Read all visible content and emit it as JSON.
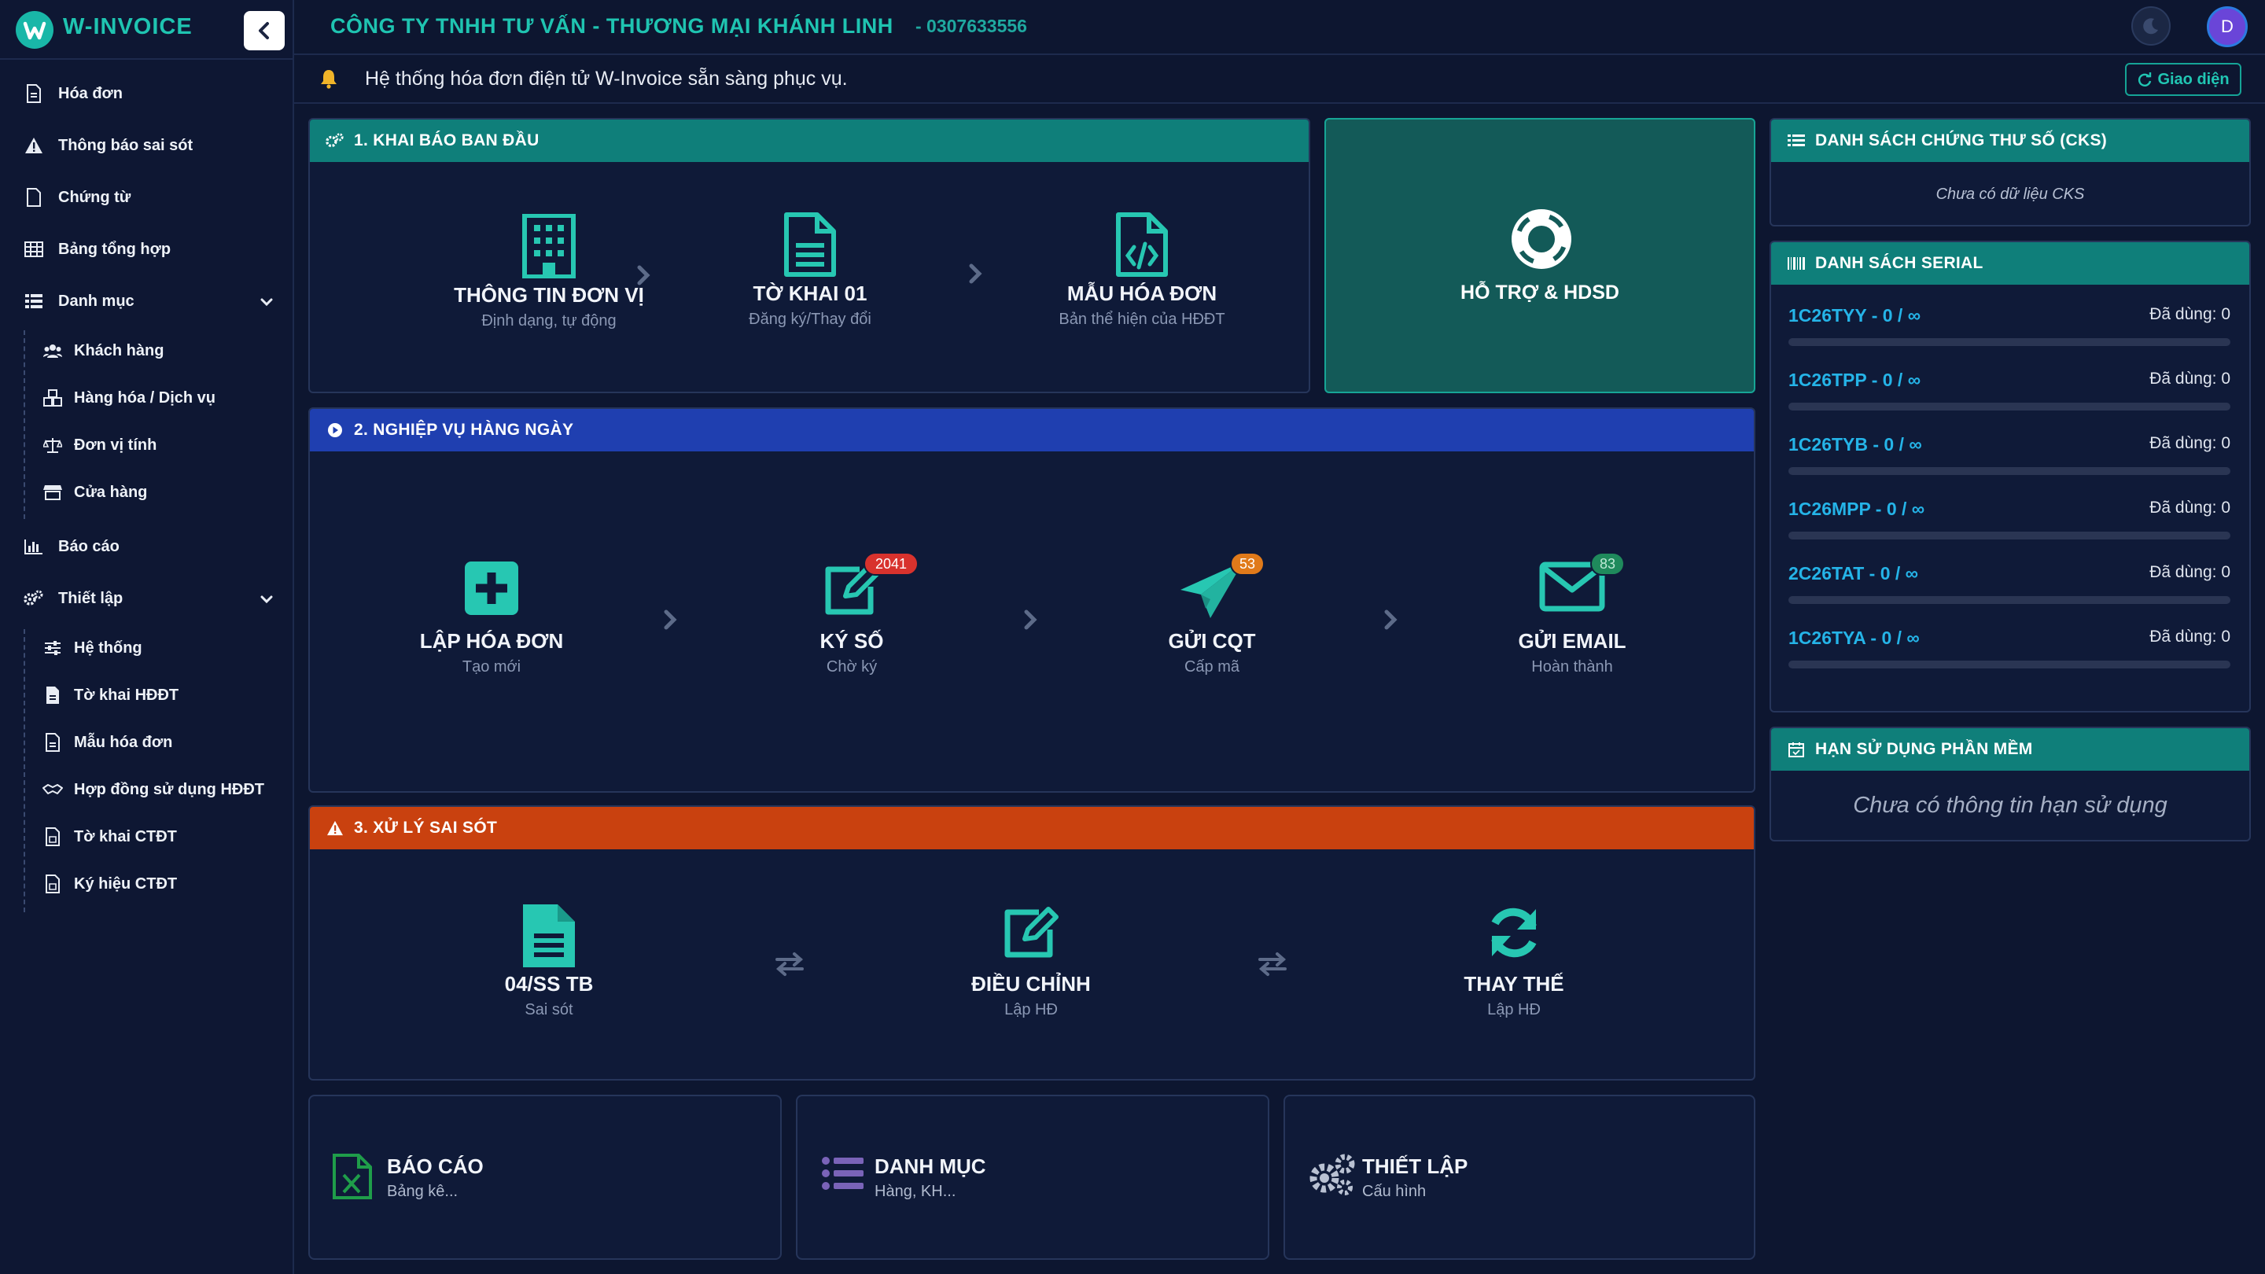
{
  "brand": {
    "name": "W-INVOICE"
  },
  "sidebar": {
    "items": [
      {
        "label": "Hóa đơn",
        "icon": "file-icon"
      },
      {
        "label": "Thông báo sai sót",
        "icon": "warning-icon"
      },
      {
        "label": "Chứng từ",
        "icon": "document-icon"
      },
      {
        "label": "Bảng tổng hợp",
        "icon": "table-icon"
      },
      {
        "label": "Danh mục",
        "icon": "list-icon"
      },
      {
        "label": "Báo cáo",
        "icon": "chart-icon"
      },
      {
        "label": "Thiết lập",
        "icon": "gears-icon"
      }
    ],
    "danh_muc_sub": [
      {
        "label": "Khách hàng"
      },
      {
        "label": "Hàng hóa / Dịch vụ"
      },
      {
        "label": "Đơn vị tính"
      },
      {
        "label": "Cửa hàng"
      }
    ],
    "thiet_lap_sub": [
      {
        "label": "Hệ thống"
      },
      {
        "label": "Tờ khai HĐĐT"
      },
      {
        "label": "Mẫu hóa đơn"
      },
      {
        "label": "Hợp đồng sử dụng HĐĐT"
      },
      {
        "label": "Tờ khai CTĐT"
      },
      {
        "label": "Ký hiệu CTĐT"
      }
    ]
  },
  "header": {
    "company": "CÔNG TY TNHH TƯ VẤN - THƯƠNG MẠI KHÁNH LINH",
    "phone": "- 0307633556",
    "avatar": "D"
  },
  "notice": {
    "text": "Hệ thống hóa đơn điện tử W-Invoice sẵn sàng phục vụ.",
    "ui_button": "Giao diện"
  },
  "section1": {
    "title": "1. KHAI BÁO BAN ĐẦU",
    "steps": [
      {
        "title": "THÔNG TIN ĐƠN VỊ",
        "sub": "Định dạng, tự động"
      },
      {
        "title": "TỜ KHAI 01",
        "sub": "Đăng ký/Thay đổi"
      },
      {
        "title": "MẪU HÓA ĐƠN",
        "sub": "Bản thể hiện của HĐĐT"
      }
    ]
  },
  "support": {
    "title": "HỖ TRỢ & HDSD"
  },
  "section2": {
    "title": "2. NGHIỆP VỤ HÀNG NGÀY",
    "steps": [
      {
        "title": "LẬP HÓA ĐƠN",
        "sub": "Tạo mới",
        "badge": ""
      },
      {
        "title": "KÝ SỐ",
        "sub": "Chờ ký",
        "badge": "2041"
      },
      {
        "title": "GỬI CQT",
        "sub": "Cấp mã",
        "badge": "53"
      },
      {
        "title": "GỬI EMAIL",
        "sub": "Hoàn thành",
        "badge": "83"
      }
    ]
  },
  "section3": {
    "title": "3. XỬ LÝ SAI SÓT",
    "steps": [
      {
        "title": "04/SS TB",
        "sub": "Sai sót"
      },
      {
        "title": "ĐIỀU CHỈNH",
        "sub": "Lập HĐ"
      },
      {
        "title": "THAY THẾ",
        "sub": "Lập HĐ"
      }
    ]
  },
  "bottom": [
    {
      "title": "BÁO CÁO",
      "sub": "Bảng kê..."
    },
    {
      "title": "DANH MỤC",
      "sub": "Hàng, KH..."
    },
    {
      "title": "THIẾT LẬP",
      "sub": "Cấu hình"
    }
  ],
  "cks": {
    "title": "DANH SÁCH CHỨNG THƯ SỐ (CKS)",
    "empty": "Chưa có dữ liệu CKS"
  },
  "serial": {
    "title": "DANH SÁCH SERIAL",
    "rows": [
      {
        "code": "1C26TYY - 0 / ∞",
        "used": "Đã dùng: 0"
      },
      {
        "code": "1C26TPP - 0 / ∞",
        "used": "Đã dùng: 0"
      },
      {
        "code": "1C26TYB - 0 / ∞",
        "used": "Đã dùng: 0"
      },
      {
        "code": "1C26MPP - 0 / ∞",
        "used": "Đã dùng: 0"
      },
      {
        "code": "2C26TAT - 0 / ∞",
        "used": "Đã dùng: 0"
      },
      {
        "code": "1C26TYA - 0 / ∞",
        "used": "Đã dùng: 0"
      }
    ]
  },
  "license": {
    "title": "HẠN SỬ DỤNG PHẦN MỀM",
    "empty": "Chưa có thông tin hạn sử dụng"
  },
  "colors": {
    "teal": "#0f7f7a",
    "blue": "#1f3fb0",
    "orange": "#c9410f",
    "accent": "#1fc4b1"
  }
}
